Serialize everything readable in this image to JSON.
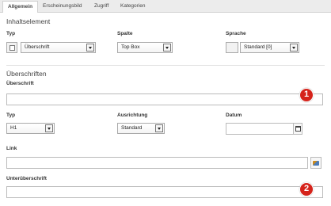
{
  "tabs": [
    "Allgemein",
    "Erscheinungsbild",
    "Zugriff",
    "Kategorien"
  ],
  "inhalt": {
    "section_title": "Inhaltselement",
    "typ_label": "Typ",
    "typ_value": "Überschrift",
    "spalte_label": "Spalte",
    "spalte_value": "Top Box",
    "sprache_label": "Sprache",
    "sprache_value": "Standard [0]"
  },
  "ueberschriften": {
    "section_title": "Überschriften",
    "ueberschrift_label": "Überschrift",
    "ueberschrift_value": "",
    "typ_label": "Typ",
    "typ_value": "H1",
    "ausrichtung_label": "Ausrichtung",
    "ausrichtung_value": "Standard",
    "datum_label": "Datum",
    "datum_value": "",
    "link_label": "Link",
    "link_value": "",
    "unterueberschrift_label": "Unterüberschrift",
    "unterueberschrift_value": ""
  },
  "badges": [
    "1",
    "2"
  ],
  "colors": {
    "badge": "#d5231b",
    "tab_bar": "#ececec"
  }
}
